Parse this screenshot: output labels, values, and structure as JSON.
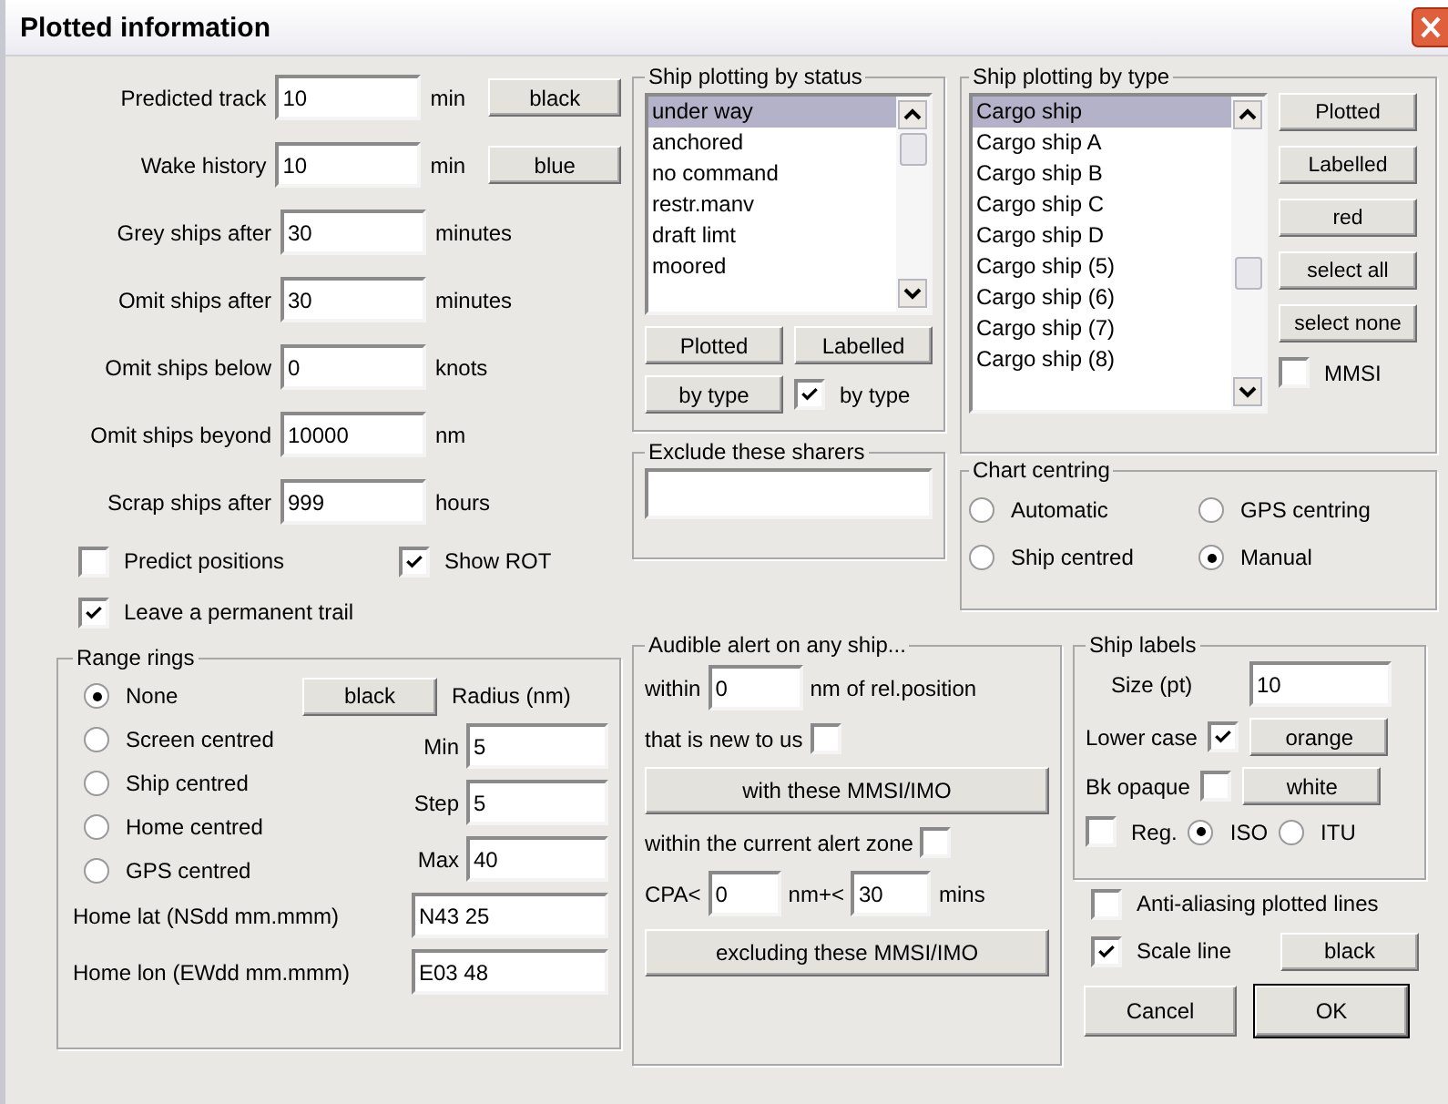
{
  "window": {
    "title": "Plotted information"
  },
  "track_fields": [
    {
      "label": "Predicted track",
      "value": "10",
      "unit": "min",
      "color_button": "black"
    },
    {
      "label": "Wake history",
      "value": "10",
      "unit": "min",
      "color_button": "blue"
    },
    {
      "label": "Grey ships after",
      "value": "30",
      "unit": "minutes"
    },
    {
      "label": "Omit ships after",
      "value": "30",
      "unit": "minutes"
    },
    {
      "label": "Omit ships below",
      "value": "0",
      "unit": "knots"
    },
    {
      "label": "Omit ships beyond",
      "value": "10000",
      "unit": "nm"
    },
    {
      "label": "Scrap ships after",
      "value": "999",
      "unit": "hours"
    }
  ],
  "predict_positions": {
    "label": "Predict positions",
    "checked": false
  },
  "show_rot": {
    "label": "Show ROT",
    "checked": true
  },
  "permanent_trail": {
    "label": "Leave a permanent trail",
    "checked": true
  },
  "range_rings": {
    "title": "Range rings",
    "color_button": "black",
    "radius_label": "Radius (nm)",
    "options": [
      {
        "label": "None",
        "selected": true
      },
      {
        "label": "Screen centred",
        "selected": false
      },
      {
        "label": "Ship centred",
        "selected": false
      },
      {
        "label": "Home centred",
        "selected": false
      },
      {
        "label": "GPS centred",
        "selected": false
      }
    ],
    "radius_fields": [
      {
        "label": "Min",
        "value": "5"
      },
      {
        "label": "Step",
        "value": "5"
      },
      {
        "label": "Max",
        "value": "40"
      }
    ],
    "home_fields": [
      {
        "label": "Home lat (NSdd mm.mmm)",
        "value": "N43 25"
      },
      {
        "label": "Home lon (EWdd mm.mmm)",
        "value": "E03 48"
      }
    ]
  },
  "status_group": {
    "title": "Ship plotting by status",
    "items": [
      {
        "label": "under way",
        "selected": true
      },
      {
        "label": "anchored",
        "selected": false
      },
      {
        "label": "no command",
        "selected": false
      },
      {
        "label": "restr.manv",
        "selected": false
      },
      {
        "label": "draft limt",
        "selected": false
      },
      {
        "label": "moored",
        "selected": false
      }
    ],
    "buttons": [
      "Plotted",
      "Labelled"
    ],
    "by_type_button": "by type",
    "by_type_checkbox": {
      "label": "by type",
      "checked": true
    }
  },
  "exclude_sharers": {
    "title": "Exclude these sharers"
  },
  "type_group": {
    "title": "Ship plotting by type",
    "items": [
      {
        "label": "Cargo ship",
        "selected": true
      },
      {
        "label": "Cargo ship A",
        "selected": false
      },
      {
        "label": "Cargo ship B",
        "selected": false
      },
      {
        "label": "Cargo ship C",
        "selected": false
      },
      {
        "label": "Cargo ship D",
        "selected": false
      },
      {
        "label": "Cargo ship (5)",
        "selected": false
      },
      {
        "label": "Cargo ship (6)",
        "selected": false
      },
      {
        "label": "Cargo ship (7)",
        "selected": false
      },
      {
        "label": "Cargo ship (8)",
        "selected": false
      }
    ],
    "buttons": [
      "Plotted",
      "Labelled",
      "red",
      "select all",
      "select none"
    ],
    "mmsi": {
      "label": "MMSI",
      "checked": false
    }
  },
  "chart_centring": {
    "title": "Chart centring",
    "options": [
      {
        "label": "Automatic",
        "selected": false
      },
      {
        "label": "GPS centring",
        "selected": false
      },
      {
        "label": "Ship centred",
        "selected": false
      },
      {
        "label": "Manual",
        "selected": true
      }
    ]
  },
  "audible_alert": {
    "title": "Audible alert on any ship...",
    "within_label": "within",
    "within_value": "0",
    "within_unit": "nm of rel.position",
    "new_to_us": {
      "label": "that is new to us",
      "checked": false
    },
    "with_button": "with these MMSI/IMO",
    "alert_zone": {
      "label": "within the current alert zone",
      "checked": false
    },
    "cpa_label": "CPA<",
    "cpa_value": "0",
    "time_label": "nm+<",
    "time_value": "30",
    "time_unit": "mins",
    "excluding_button": "excluding these MMSI/IMO"
  },
  "ship_labels": {
    "title": "Ship labels",
    "size_label": "Size (pt)",
    "size_value": "10",
    "lower_case": {
      "label": "Lower case",
      "checked": true
    },
    "lower_case_color": "orange",
    "bk_opaque": {
      "label": "Bk opaque",
      "checked": false
    },
    "bk_opaque_color": "white",
    "reg": {
      "label": "Reg.",
      "checked": false
    },
    "standards": [
      {
        "label": "ISO",
        "selected": true
      },
      {
        "label": "ITU",
        "selected": false
      }
    ]
  },
  "anti_aliasing": {
    "label": "Anti-aliasing plotted lines",
    "checked": false
  },
  "scale_line": {
    "label": "Scale line",
    "checked": true
  },
  "scale_line_color": "black",
  "buttons": [
    {
      "label": "Cancel",
      "default": false
    },
    {
      "label": "OK",
      "default": true
    }
  ]
}
